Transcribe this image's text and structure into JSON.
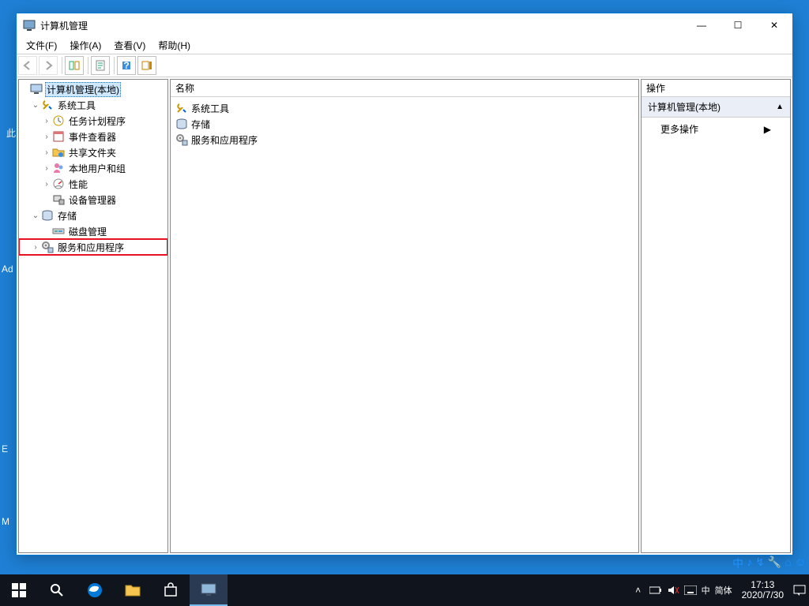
{
  "window": {
    "title": "计算机管理",
    "menubar": [
      "文件(F)",
      "操作(A)",
      "查看(V)",
      "帮助(H)"
    ],
    "win_controls": {
      "min": "—",
      "max": "☐",
      "close": "✕"
    }
  },
  "tree": {
    "root": "计算机管理(本地)",
    "system_tools": "系统工具",
    "task_scheduler": "任务计划程序",
    "event_viewer": "事件查看器",
    "shared_folders": "共享文件夹",
    "local_users": "本地用户和组",
    "performance": "性能",
    "device_manager": "设备管理器",
    "storage": "存储",
    "disk_mgmt": "磁盘管理",
    "services_apps": "服务和应用程序"
  },
  "content": {
    "header": "名称",
    "items": [
      "系统工具",
      "存储",
      "服务和应用程序"
    ]
  },
  "actions": {
    "header": "操作",
    "section": "计算机管理(本地)",
    "more": "更多操作"
  },
  "taskbar": {
    "time": "17:13",
    "date": "2020/7/30",
    "ime": "中",
    "ime2": "简体"
  },
  "desktop": {
    "d1": "此",
    "d2": "Ad",
    "d3": "E",
    "d4": "M"
  }
}
